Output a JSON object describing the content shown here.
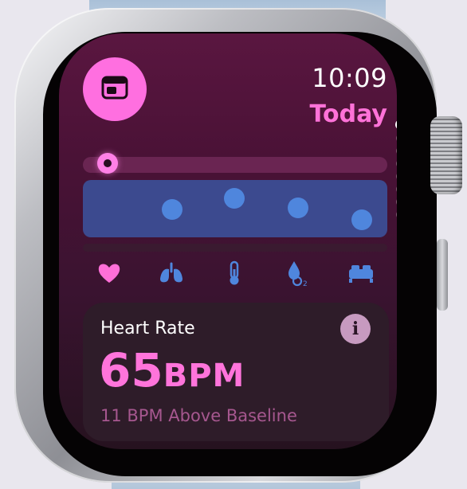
{
  "watch": {
    "time": "10:09",
    "date_label": "Today",
    "page_indicator": {
      "count": 8,
      "active_index": 0
    }
  },
  "colors": {
    "accent_pink": "#ff72d8",
    "respiratory_blue": "#4f86dd",
    "background_plum": "#4a1236"
  },
  "icons": {
    "app": "card-icon",
    "metrics": [
      "heart-icon",
      "lungs-icon",
      "thermometer-icon",
      "blood-oxygen-icon",
      "bed-icon"
    ]
  },
  "card": {
    "title": "Heart Rate",
    "value": "65",
    "unit": "BPM",
    "subtitle": "11 BPM Above Baseline"
  }
}
